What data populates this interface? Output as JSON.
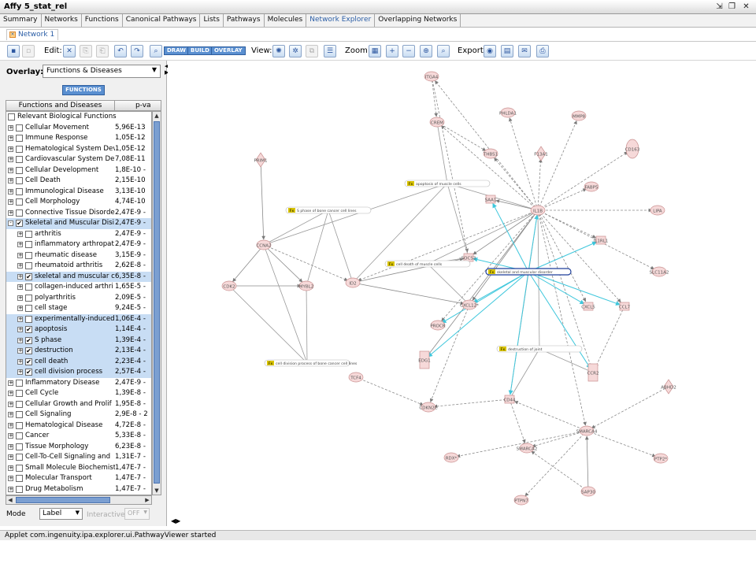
{
  "window": {
    "title": "Affy 5_stat_rel"
  },
  "tabs": [
    "Summary",
    "Networks",
    "Functions",
    "Canonical Pathways",
    "Lists",
    "Pathways",
    "Molecules",
    "Network Explorer",
    "Overlapping Networks"
  ],
  "active_tab": "Network Explorer",
  "subtab": "Network 1",
  "toolbar": {
    "edit_label": "Edit:",
    "draw_label": "DRAW",
    "build_label": "BUILD",
    "overlay_label": "OVERLAY",
    "view_label": "View:",
    "zoom_label": "Zoom:",
    "export_label": "Export:"
  },
  "overlay": {
    "label": "Overlay:",
    "selected": "Functions & Diseases",
    "functions_button": "FUNCTIONS"
  },
  "table": {
    "col1": "Functions and Diseases",
    "col2": "p-va",
    "header_row": "Relevant Biological Functions",
    "rows": [
      {
        "name": "Cellular Movement",
        "p": "5,96E-13",
        "level": 0,
        "exp": "+",
        "checked": false,
        "sel": false
      },
      {
        "name": "Immune Response",
        "p": "1,05E-12",
        "level": 0,
        "exp": "+",
        "checked": false,
        "sel": false
      },
      {
        "name": "Hematological System Dev",
        "p": "1,05E-12",
        "level": 0,
        "exp": "+",
        "checked": false,
        "sel": false
      },
      {
        "name": "Cardiovascular System De",
        "p": "7,08E-11",
        "level": 0,
        "exp": "+",
        "checked": false,
        "sel": false
      },
      {
        "name": "Cellular Development",
        "p": "1,8E-10 -",
        "level": 0,
        "exp": "+",
        "checked": false,
        "sel": false
      },
      {
        "name": "Cell Death",
        "p": "2,15E-10",
        "level": 0,
        "exp": "+",
        "checked": false,
        "sel": false
      },
      {
        "name": "Immunological Disease",
        "p": "3,13E-10",
        "level": 0,
        "exp": "+",
        "checked": false,
        "sel": false
      },
      {
        "name": "Cell Morphology",
        "p": "4,74E-10",
        "level": 0,
        "exp": "+",
        "checked": false,
        "sel": false
      },
      {
        "name": "Connective Tissue Disorde",
        "p": "2,47E-9 -",
        "level": 0,
        "exp": "+",
        "checked": false,
        "sel": false
      },
      {
        "name": "Skeletal and Muscular Disi",
        "p": "2,47E-9 -",
        "level": 0,
        "exp": "-",
        "checked": true,
        "sel": true
      },
      {
        "name": "arthritis",
        "p": "2,47E-9 -",
        "level": 1,
        "exp": "+",
        "checked": false,
        "sel": false
      },
      {
        "name": "inflammatory arthropat",
        "p": "2,47E-9 -",
        "level": 1,
        "exp": "+",
        "checked": false,
        "sel": false
      },
      {
        "name": "rheumatic disease",
        "p": "3,15E-9 -",
        "level": 1,
        "exp": "+",
        "checked": false,
        "sel": false
      },
      {
        "name": "rheumatoid arthritis",
        "p": "2,62E-8 -",
        "level": 1,
        "exp": "+",
        "checked": false,
        "sel": false
      },
      {
        "name": "skeletal and muscular c",
        "p": "6,35E-8 -",
        "level": 1,
        "exp": "+",
        "checked": true,
        "sel": true
      },
      {
        "name": "collagen-induced arthri",
        "p": "1,65E-5 -",
        "level": 1,
        "exp": "+",
        "checked": false,
        "sel": false
      },
      {
        "name": "polyarthritis",
        "p": "2,09E-5 -",
        "level": 1,
        "exp": "+",
        "checked": false,
        "sel": false
      },
      {
        "name": "cell stage",
        "p": "9,24E-5 -",
        "level": 1,
        "exp": "+",
        "checked": false,
        "sel": false
      },
      {
        "name": "experimentally-induced",
        "p": "1,06E-4 -",
        "level": 1,
        "exp": "+",
        "checked": false,
        "sel": true
      },
      {
        "name": "apoptosis",
        "p": "1,14E-4 -",
        "level": 1,
        "exp": "+",
        "checked": true,
        "sel": true
      },
      {
        "name": "S phase",
        "p": "1,39E-4 -",
        "level": 1,
        "exp": "+",
        "checked": true,
        "sel": true
      },
      {
        "name": "destruction",
        "p": "2,13E-4 -",
        "level": 1,
        "exp": "+",
        "checked": true,
        "sel": true
      },
      {
        "name": "cell death",
        "p": "2,23E-4 -",
        "level": 1,
        "exp": "+",
        "checked": true,
        "sel": true
      },
      {
        "name": "cell division process",
        "p": "2,57E-4 -",
        "level": 1,
        "exp": "+",
        "checked": true,
        "sel": true
      },
      {
        "name": "Inflammatory Disease",
        "p": "2,47E-9 -",
        "level": 0,
        "exp": "+",
        "checked": false,
        "sel": false
      },
      {
        "name": "Cell Cycle",
        "p": "1,39E-8 -",
        "level": 0,
        "exp": "+",
        "checked": false,
        "sel": false
      },
      {
        "name": "Cellular Growth and Prolif",
        "p": "1,95E-8 -",
        "level": 0,
        "exp": "+",
        "checked": false,
        "sel": false
      },
      {
        "name": "Cell Signaling",
        "p": "2,9E-8 - 2",
        "level": 0,
        "exp": "+",
        "checked": false,
        "sel": false
      },
      {
        "name": "Hematological Disease",
        "p": "4,72E-8 -",
        "level": 0,
        "exp": "+",
        "checked": false,
        "sel": false
      },
      {
        "name": "Cancer",
        "p": "5,33E-8 -",
        "level": 0,
        "exp": "+",
        "checked": false,
        "sel": false
      },
      {
        "name": "Tissue Morphology",
        "p": "6,23E-8 -",
        "level": 0,
        "exp": "+",
        "checked": false,
        "sel": false
      },
      {
        "name": "Cell-To-Cell Signaling and",
        "p": "1,31E-7 -",
        "level": 0,
        "exp": "+",
        "checked": false,
        "sel": false
      },
      {
        "name": "Small Molecule Biochemist",
        "p": "1,47E-7 -",
        "level": 0,
        "exp": "+",
        "checked": false,
        "sel": false
      },
      {
        "name": "Molecular Transport",
        "p": "1,47E-7 -",
        "level": 0,
        "exp": "+",
        "checked": false,
        "sel": false
      },
      {
        "name": "Drug Metabolism",
        "p": "1,47E-7 -",
        "level": 0,
        "exp": "+",
        "checked": false,
        "sel": false
      }
    ]
  },
  "mode": {
    "label": "Mode",
    "value": "Label",
    "interactive_label": "Interactive",
    "interactive_value": "OFF"
  },
  "status": "Applet com.ingenuity.ipa.explorer.ui.PathwayViewer started",
  "network": {
    "nodes": [
      "ITGA4",
      "PHLDA1",
      "MMP8",
      "CREM",
      "THBS1",
      "F13A1",
      "CD163",
      "PRIM1",
      "FABP5",
      "SAA1",
      "IL1B",
      "LIPA",
      "CCNA2",
      "SOCS3",
      "IL1RL1",
      "SLC11A2",
      "CDK2",
      "MYBL2",
      "ID2",
      "CXCL12*",
      "CXCL5",
      "CCL7",
      "PROCR",
      "EDG1",
      "CCR2",
      "TCF4",
      "ABHD2",
      "CDKN2C",
      "CD44",
      "SMARCA4",
      "SMARCA2",
      "RDX*",
      "PTP2*",
      "PTPN7",
      "SAP30"
    ],
    "functions": [
      "apoptosis of muscle cells",
      "S phase of bone cancer cell lines",
      "cell death of muscle cells",
      "skeletal and muscular disorder",
      "destruction of joint",
      "cell division process of bone cancer cell lines"
    ],
    "function_tag": "Fx"
  },
  "colors": {
    "highlight_edge": "#3fc7dc",
    "node_fill": "#f6d9d9",
    "node_stroke": "#c98f8f",
    "accent": "#2b5ea6"
  }
}
